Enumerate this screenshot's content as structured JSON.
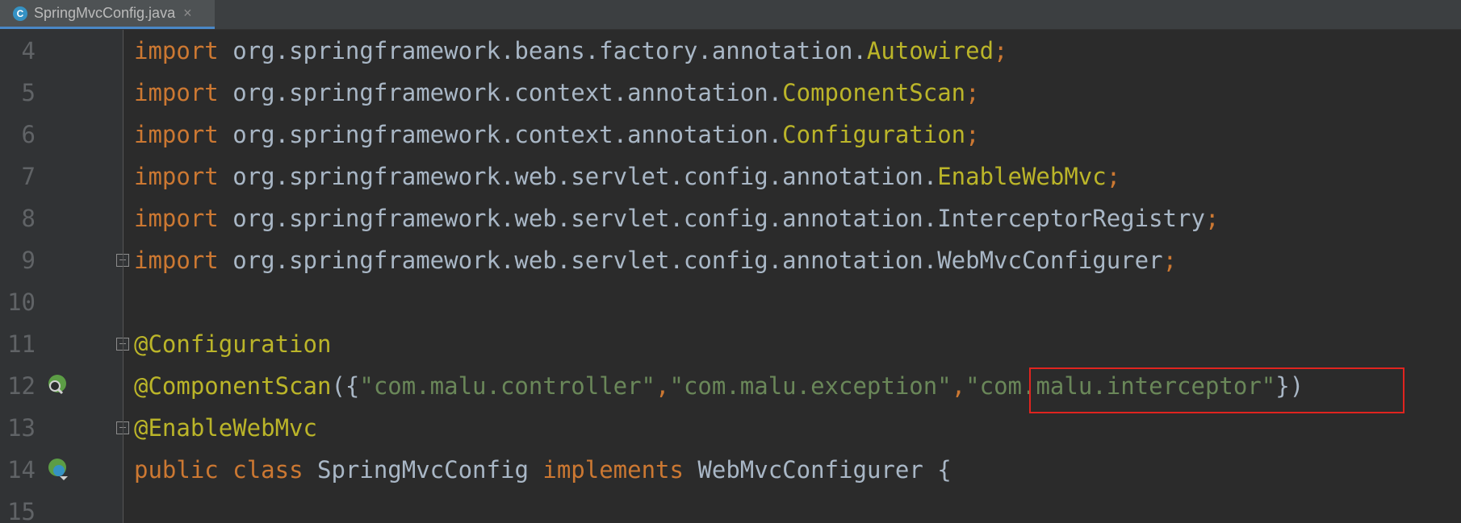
{
  "tab": {
    "icon": "java-class-icon",
    "icon_letter": "C",
    "filename": "SpringMvcConfig.java",
    "close": "×"
  },
  "lines": [
    {
      "n": "4",
      "tokens": [
        [
          "import",
          "kw"
        ],
        [
          " org.springframework.beans.factory.annotation.",
          ""
        ],
        [
          "Autowired",
          "cls"
        ],
        [
          ";",
          "kw"
        ]
      ]
    },
    {
      "n": "5",
      "tokens": [
        [
          "import",
          "kw"
        ],
        [
          " org.springframework.context.annotation.",
          ""
        ],
        [
          "ComponentScan",
          "cls"
        ],
        [
          ";",
          "kw"
        ]
      ]
    },
    {
      "n": "6",
      "tokens": [
        [
          "import",
          "kw"
        ],
        [
          " org.springframework.context.annotation.",
          ""
        ],
        [
          "Configuration",
          "cls"
        ],
        [
          ";",
          "kw"
        ]
      ]
    },
    {
      "n": "7",
      "tokens": [
        [
          "import",
          "kw"
        ],
        [
          " org.springframework.web.servlet.config.annotation.",
          ""
        ],
        [
          "EnableWebMvc",
          "cls"
        ],
        [
          ";",
          "kw"
        ]
      ]
    },
    {
      "n": "8",
      "tokens": [
        [
          "import",
          "kw"
        ],
        [
          " org.springframework.web.servlet.config.annotation.InterceptorRegistry",
          ""
        ],
        [
          ";",
          "kw"
        ]
      ]
    },
    {
      "n": "9",
      "tokens": [
        [
          "import",
          "kw"
        ],
        [
          " org.springframework.web.servlet.config.annotation.WebMvcConfigurer",
          ""
        ],
        [
          ";",
          "kw"
        ]
      ]
    },
    {
      "n": "10",
      "tokens": []
    },
    {
      "n": "11",
      "tokens": [
        [
          "@Configuration",
          "ann"
        ]
      ]
    },
    {
      "n": "12",
      "tokens": [
        [
          "@ComponentScan",
          "ann"
        ],
        [
          "({",
          ""
        ],
        [
          "\"com.malu.controller\"",
          "str"
        ],
        [
          ",",
          "kw"
        ],
        [
          "\"com.malu.exception\"",
          "str"
        ],
        [
          ",",
          "kw"
        ],
        [
          "\"com.malu.interceptor\"",
          "str"
        ],
        [
          "})",
          ""
        ]
      ]
    },
    {
      "n": "13",
      "tokens": [
        [
          "@EnableWebMvc",
          "ann"
        ]
      ]
    },
    {
      "n": "14",
      "tokens": [
        [
          "public",
          "kw"
        ],
        [
          " ",
          ""
        ],
        [
          "class",
          "kw"
        ],
        [
          " SpringMvcConfig ",
          ""
        ],
        [
          "implements",
          "kw"
        ],
        [
          " WebMvcConfigurer {",
          ""
        ]
      ]
    },
    {
      "n": "15",
      "tokens": []
    }
  ],
  "gutter_icons": {
    "line12": "spring-bean-search-icon",
    "line14": "spring-config-class-icon"
  },
  "colors": {
    "keyword": "#cc7832",
    "annotation": "#bbb529",
    "string": "#6a8759",
    "text": "#a9b7c6",
    "highlight_box": "#e0241f"
  }
}
